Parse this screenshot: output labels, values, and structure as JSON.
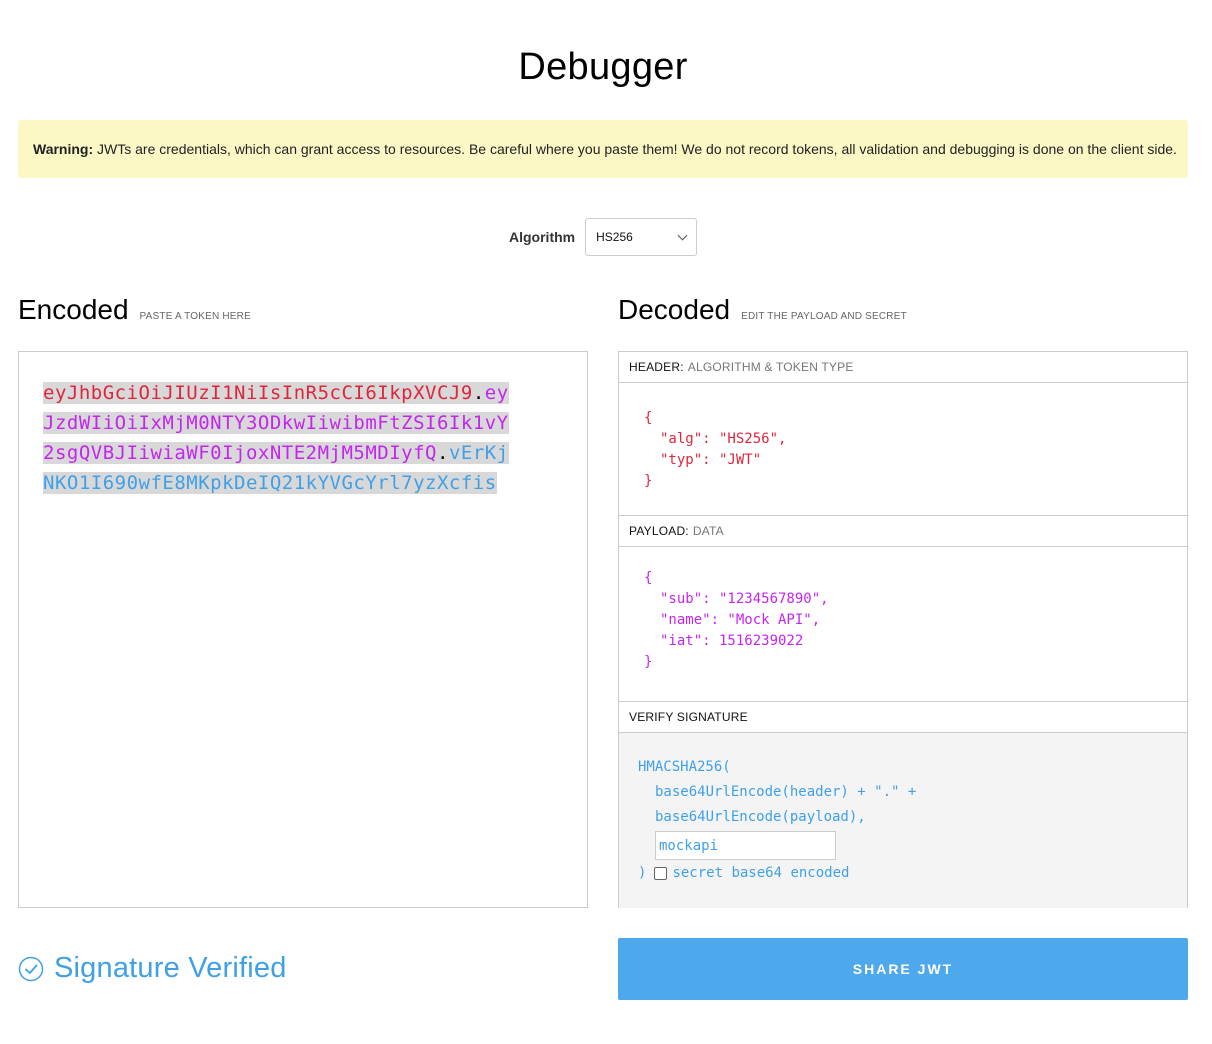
{
  "page": {
    "title": "Debugger"
  },
  "warning": {
    "label": "Warning:",
    "text": " JWTs are credentials, which can grant access to resources. Be careful where you paste them! We do not record tokens, all validation and debugging is done on the client side."
  },
  "algorithm": {
    "label": "Algorithm",
    "selected": "HS256"
  },
  "encoded": {
    "title": "Encoded",
    "subtitle": "PASTE A TOKEN HERE",
    "lines": [
      [
        {
          "text": "eyJhbGciOiJIUzI1NiIsInR5cCI6IkpXVCJ9",
          "part": "head"
        },
        {
          "text": ".",
          "part": "dot"
        },
        {
          "text": "ey",
          "part": "pay"
        }
      ],
      [
        {
          "text": "JzdWIiOiIxMjM0NTY3ODkwIiwibmFtZSI6Ik1vY",
          "part": "pay"
        }
      ],
      [
        {
          "text": "2sgQVBJIiwiaWF0IjoxNTE2MjM5MDIyfQ",
          "part": "pay"
        },
        {
          "text": ".",
          "part": "dot"
        },
        {
          "text": "vErKj",
          "part": "sig"
        }
      ],
      [
        {
          "text": "NKO1I690wfE8MKpkDeIQ21kYVGcYrl7yzXcfis",
          "part": "sig"
        }
      ]
    ]
  },
  "decoded": {
    "title": "Decoded",
    "subtitle": "EDIT THE PAYLOAD AND SECRET",
    "header": {
      "label": "HEADER:",
      "sublabel": "ALGORITHM & TOKEN TYPE",
      "lines": [
        "{",
        "\"alg\": \"HS256\",",
        "\"typ\": \"JWT\"",
        "}"
      ]
    },
    "payload": {
      "label": "PAYLOAD:",
      "sublabel": "DATA",
      "lines": [
        "{",
        "\"sub\": \"1234567890\",",
        "\"name\": \"Mock API\",",
        "\"iat\": 1516239022",
        "}"
      ]
    },
    "signature": {
      "label": "VERIFY SIGNATURE",
      "func": "HMACSHA256(",
      "line1": "base64UrlEncode(header) + \".\" +",
      "line2": "base64UrlEncode(payload),",
      "secret": "mockapi",
      "close": ")",
      "checkbox_label": "secret base64 encoded",
      "checkbox_checked": false
    }
  },
  "status": {
    "text": "Signature Verified",
    "color": "#3fa0e8"
  },
  "share_button": {
    "label": "SHARE JWT",
    "color": "#4ea8ec"
  }
}
